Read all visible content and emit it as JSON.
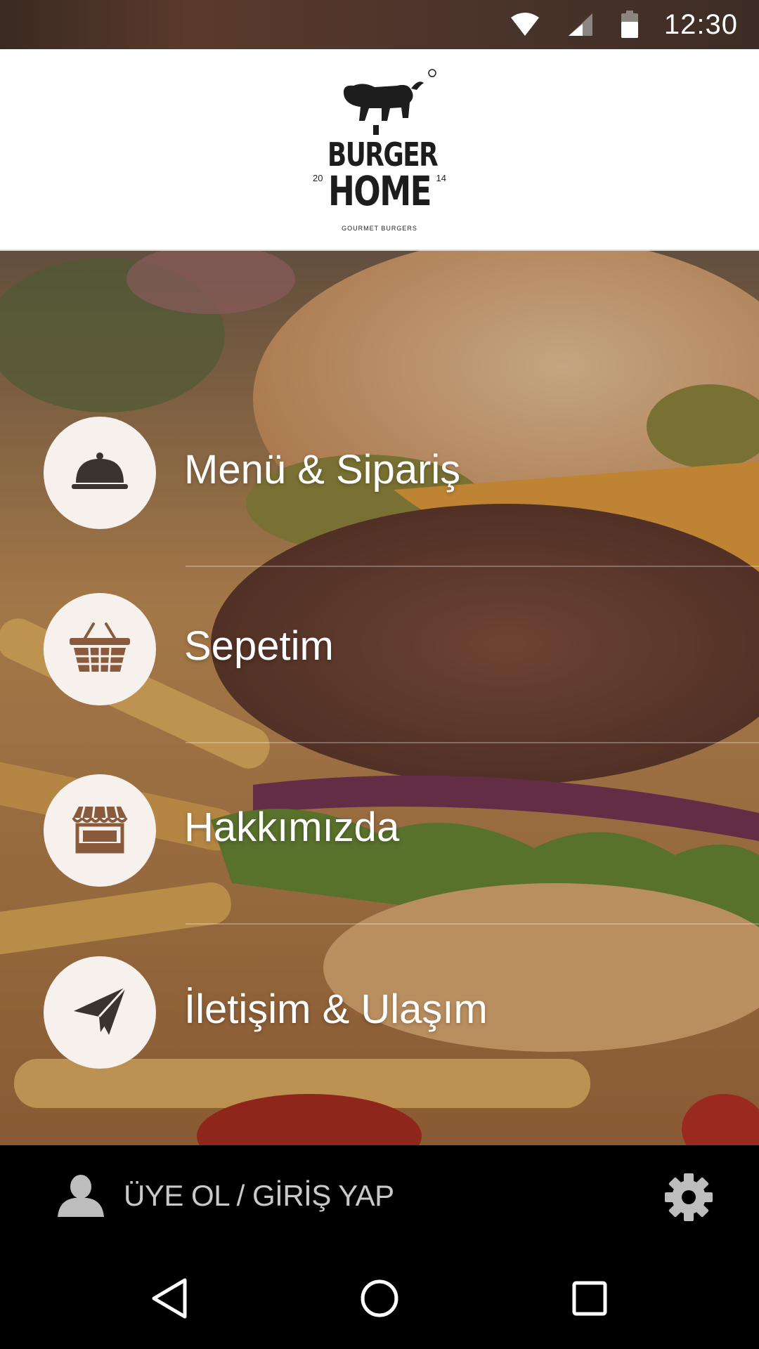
{
  "status_bar": {
    "time": "12:30",
    "icons": [
      "wifi-icon",
      "cell-signal-icon",
      "battery-icon"
    ]
  },
  "header": {
    "logo": {
      "line1": "BURGER",
      "line2": "HOME",
      "tagline": "GOURMET BURGERS",
      "year_left": "20",
      "year_right": "14"
    }
  },
  "menu": {
    "items": [
      {
        "label": "Menü & Sipariş",
        "icon": "cloche-icon"
      },
      {
        "label": "Sepetim",
        "icon": "basket-icon"
      },
      {
        "label": "Hakkımızda",
        "icon": "storefront-icon"
      },
      {
        "label": "İletişim & Ulaşım",
        "icon": "paper-plane-icon"
      }
    ]
  },
  "account": {
    "login_label": "ÜYE OL / GİRİŞ YAP",
    "user_icon": "user-icon",
    "settings_icon": "gear-icon"
  },
  "nav": {
    "buttons": [
      "back-icon",
      "home-icon",
      "recents-icon"
    ]
  },
  "colors": {
    "icon_brown": "#8a5a3c",
    "circle_bg": "#f6f1ec",
    "header_bg": "#ffffff",
    "account_bar_bg": "#000000",
    "label_gray": "#c9c9c9"
  }
}
